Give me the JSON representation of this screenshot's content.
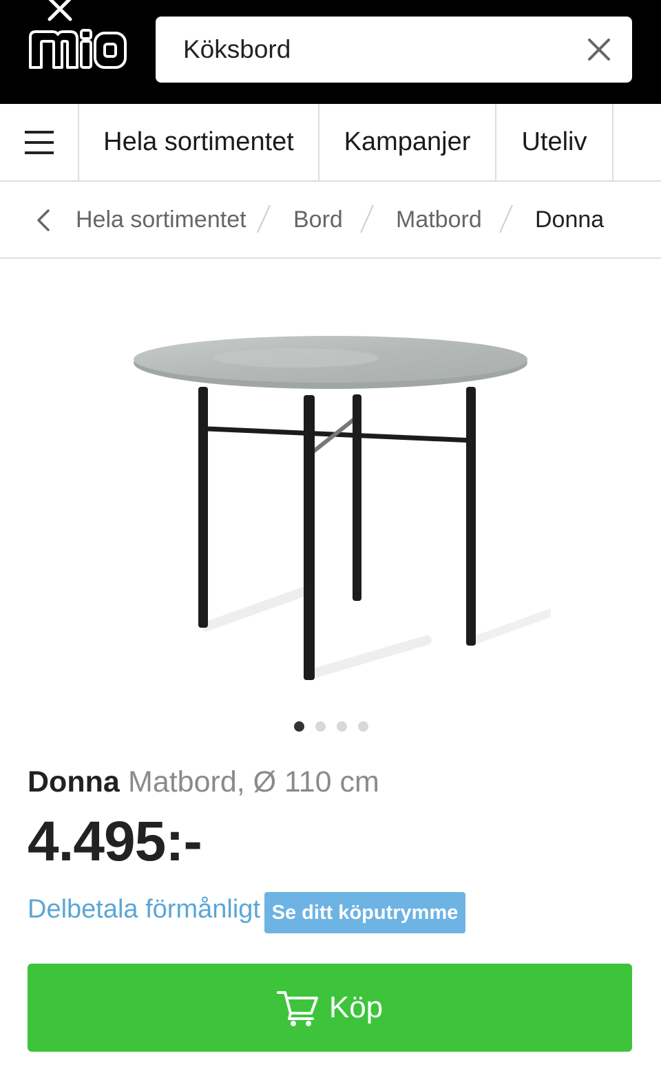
{
  "header": {
    "logo_text": "mio",
    "search": {
      "value": "Köksbord"
    }
  },
  "catnav": {
    "items": [
      {
        "label": "Hela sortimentet"
      },
      {
        "label": "Kampanjer"
      },
      {
        "label": "Uteliv"
      }
    ]
  },
  "breadcrumb": {
    "items": [
      "Hela sortimentet",
      "Bord",
      "Matbord",
      "Donna"
    ]
  },
  "gallery": {
    "total": 4,
    "active_index": 0
  },
  "product": {
    "name": "Donna",
    "description": "Matbord, Ø 110 cm",
    "price": "4.495:-"
  },
  "financing": {
    "link_label": "Delbetala förmånligt",
    "button_label": "Se ditt köputrymme"
  },
  "buy": {
    "label": "Köp"
  },
  "colors": {
    "header_bg": "#000000",
    "link": "#5ba6d6",
    "credit_button": "#6db3e3",
    "buy_button": "#3dc43b"
  }
}
